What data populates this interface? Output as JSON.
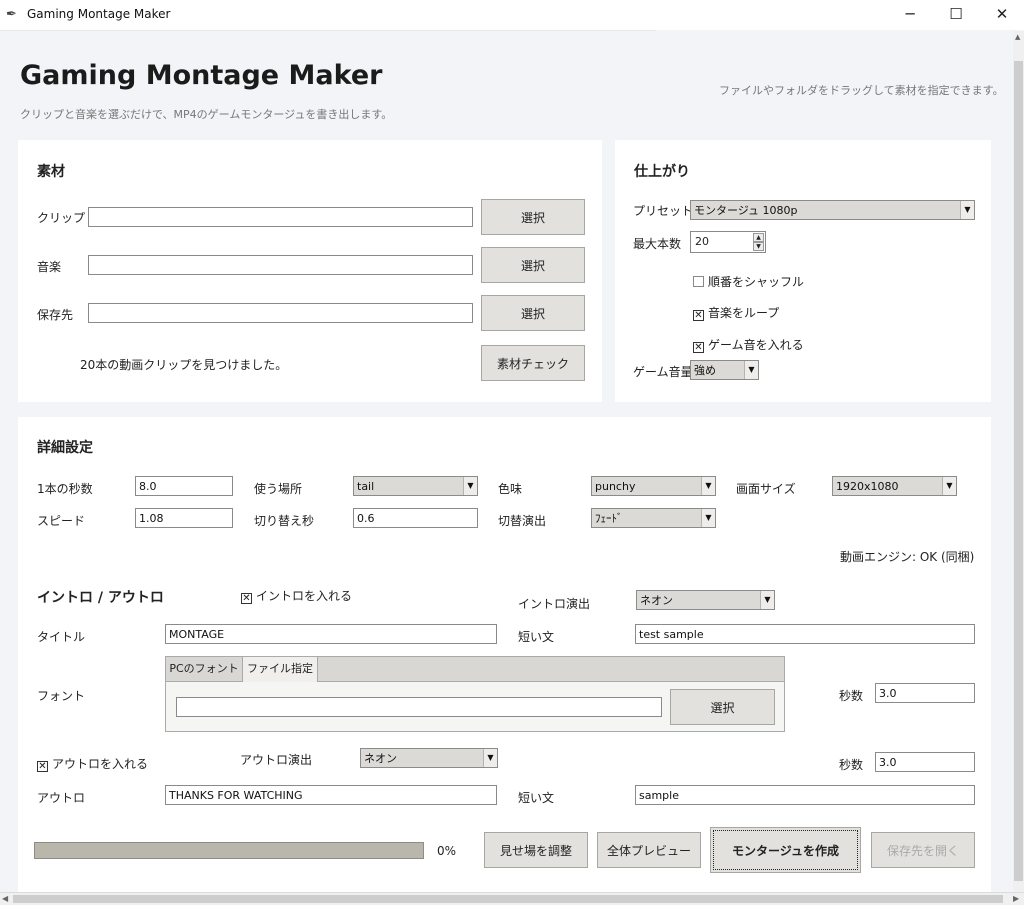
{
  "window": {
    "title": "Gaming Montage Maker",
    "minimize": "─",
    "maximize": "☐",
    "close": "✕"
  },
  "header": {
    "title": "Gaming Montage Maker",
    "subtitle": "クリップと音楽を選ぶだけで、MP4のゲームモンタージュを書き出します。",
    "hint": "ファイルやフォルダをドラッグして素材を指定できます。"
  },
  "materials": {
    "title": "素材",
    "clip_label": "クリップ",
    "clip_value": "",
    "music_label": "音楽",
    "music_value": "",
    "output_label": "保存先",
    "output_value": "",
    "select_label": "選択",
    "status": "20本の動画クリップを見つけました。",
    "check_label": "素材チェック"
  },
  "finish": {
    "title": "仕上がり",
    "preset_label": "プリセット",
    "preset_value": "モンタージュ 1080p",
    "max_label": "最大本数",
    "max_value": "20",
    "shuffle_label": "順番をシャッフル",
    "shuffle_checked": false,
    "loop_label": "音楽をループ",
    "loop_checked": true,
    "gameaudio_label": "ゲーム音を入れる",
    "gameaudio_checked": true,
    "volume_label": "ゲーム音量",
    "volume_value": "強め",
    "check_mark": "✕"
  },
  "detail": {
    "title": "詳細設定",
    "sec_label": "1本の秒数",
    "sec_value": "8.0",
    "place_label": "使う場所",
    "place_value": "tail",
    "color_label": "色味",
    "color_value": "punchy",
    "size_label": "画面サイズ",
    "size_value": "1920x1080",
    "speed_label": "スピード",
    "speed_value": "1.08",
    "switch_label": "切り替え秒",
    "switch_value": "0.6",
    "transition_label": "切替演出",
    "transition_value": "ﾌｪｰﾄﾞ",
    "engine_status": "動画エンジン: OK (同梱)"
  },
  "intro": {
    "title": "イントロ / アウトロ",
    "include_label": "イントロを入れる",
    "include_checked": true,
    "effect_label": "イントロ演出",
    "effect_value": "ネオン",
    "title_label": "タイトル",
    "title_value": "MONTAGE",
    "short_label": "短い文",
    "short_value": "test sample",
    "font_label": "フォント",
    "tab_pc": "PCのフォント",
    "tab_file": "ファイル指定",
    "font_path_value": "",
    "font_select_label": "選択",
    "seconds_label": "秒数",
    "seconds_value": "3.0"
  },
  "outro": {
    "include_label": "アウトロを入れる",
    "include_checked": true,
    "effect_label": "アウトロ演出",
    "effect_value": "ネオン",
    "seconds_label": "秒数",
    "seconds_value": "3.0",
    "outro_label": "アウトロ",
    "outro_value": "THANKS FOR WATCHING",
    "short_label": "短い文",
    "short_value": "sample"
  },
  "actions": {
    "progress_percent": 0,
    "progress_text": "0%",
    "adjust_label": "見せ場を調整",
    "preview_label": "全体プレビュー",
    "create_label": "モンタージュを作成",
    "open_label": "保存先を開く"
  }
}
